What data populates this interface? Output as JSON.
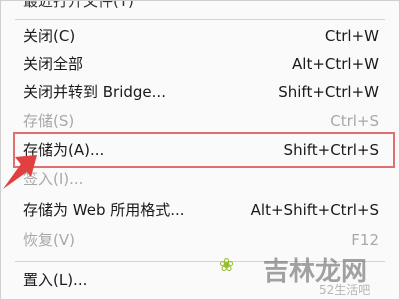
{
  "top_clipped_text": "最近打开文件(T)",
  "menu": {
    "items": [
      {
        "label": "关闭(C)",
        "shortcut": "Ctrl+W",
        "disabled": false
      },
      {
        "label": "关闭全部",
        "shortcut": "Alt+Ctrl+W",
        "disabled": false
      },
      {
        "label": "关闭并转到 Bridge...",
        "shortcut": "Shift+Ctrl+W",
        "disabled": false
      },
      {
        "label": "存储(S)",
        "shortcut": "Ctrl+S",
        "disabled": true
      },
      {
        "label": "存储为(A)...",
        "shortcut": "Shift+Ctrl+S",
        "disabled": false,
        "highlighted": true
      },
      {
        "label": "签入(I)...",
        "shortcut": "",
        "disabled": true
      },
      {
        "label": "存储为 Web 所用格式...",
        "shortcut": "Alt+Shift+Ctrl+S",
        "disabled": false
      },
      {
        "label": "恢复(V)",
        "shortcut": "F12",
        "disabled": true
      },
      {
        "label": "置入(L)...",
        "shortcut": "",
        "disabled": false
      }
    ]
  },
  "annotation": {
    "box_color": "#e07070",
    "arrow_color": "#e04040"
  },
  "watermark": {
    "brand": "吉林龙网",
    "sub": "52生活吧"
  }
}
